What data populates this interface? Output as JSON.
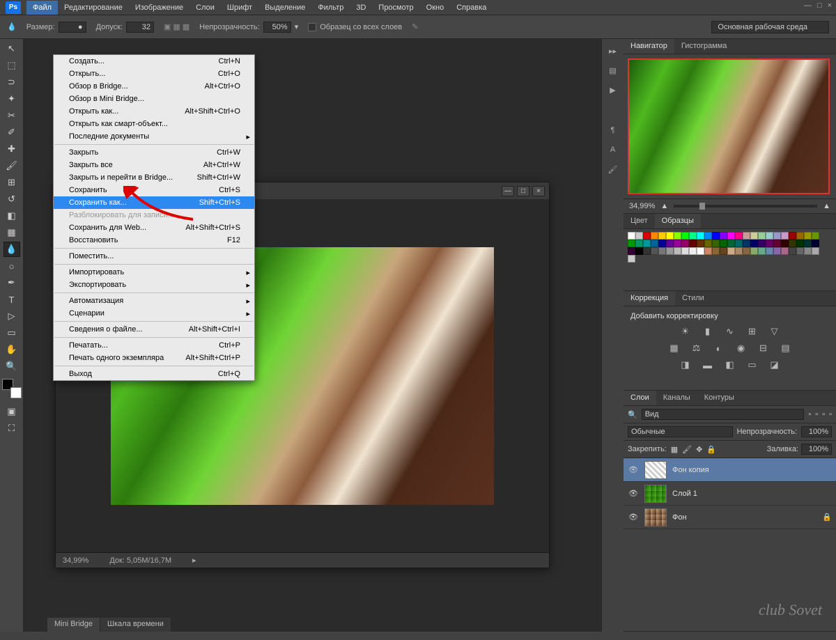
{
  "menubar": [
    "Файл",
    "Редактирование",
    "Изображение",
    "Слои",
    "Шрифт",
    "Выделение",
    "Фильтр",
    "3D",
    "Просмотр",
    "Окно",
    "Справка"
  ],
  "active_menu_index": 0,
  "options": {
    "size_label": "Размер:",
    "tolerance_label": "Допуск:",
    "tolerance_value": "32",
    "opacity_label": "Непрозрачность:",
    "opacity_value": "50%",
    "sample_all_label": "Образец со всех слоев",
    "workspace": "Основная рабочая среда"
  },
  "file_menu": [
    {
      "label": "Создать...",
      "shortcut": "Ctrl+N"
    },
    {
      "label": "Открыть...",
      "shortcut": "Ctrl+O"
    },
    {
      "label": "Обзор в Bridge...",
      "shortcut": "Alt+Ctrl+O"
    },
    {
      "label": "Обзор в Mini Bridge..."
    },
    {
      "label": "Открыть как...",
      "shortcut": "Alt+Shift+Ctrl+O"
    },
    {
      "label": "Открыть как смарт-объект..."
    },
    {
      "label": "Последние документы",
      "submenu": true
    },
    {
      "sep": true
    },
    {
      "label": "Закрыть",
      "shortcut": "Ctrl+W"
    },
    {
      "label": "Закрыть все",
      "shortcut": "Alt+Ctrl+W"
    },
    {
      "label": "Закрыть и перейти в Bridge...",
      "shortcut": "Shift+Ctrl+W"
    },
    {
      "label": "Сохранить",
      "shortcut": "Ctrl+S"
    },
    {
      "label": "Сохранить как...",
      "shortcut": "Shift+Ctrl+S",
      "highlighted": true
    },
    {
      "label": "Разблокировать для записи...",
      "disabled": true
    },
    {
      "label": "Сохранить для Web...",
      "shortcut": "Alt+Shift+Ctrl+S"
    },
    {
      "label": "Восстановить",
      "shortcut": "F12"
    },
    {
      "sep": true
    },
    {
      "label": "Поместить..."
    },
    {
      "sep": true
    },
    {
      "label": "Импортировать",
      "submenu": true
    },
    {
      "label": "Экспортировать",
      "submenu": true
    },
    {
      "sep": true
    },
    {
      "label": "Автоматизация",
      "submenu": true
    },
    {
      "label": "Сценарии",
      "submenu": true
    },
    {
      "sep": true
    },
    {
      "label": "Сведения о файле...",
      "shortcut": "Alt+Shift+Ctrl+I"
    },
    {
      "sep": true
    },
    {
      "label": "Печатать...",
      "shortcut": "Ctrl+P"
    },
    {
      "label": "Печать одного экземпляра",
      "shortcut": "Alt+Shift+Ctrl+P"
    },
    {
      "sep": true
    },
    {
      "label": "Выход",
      "shortcut": "Ctrl+Q"
    }
  ],
  "doc": {
    "zoom": "34,99%",
    "status": "Док: 5,05M/16,7M"
  },
  "navigator": {
    "tab1": "Навигатор",
    "tab2": "Гистограмма",
    "zoom": "34,99%"
  },
  "color_panel": {
    "tab1": "Цвет",
    "tab2": "Образцы"
  },
  "adjustments": {
    "tab1": "Коррекция",
    "tab2": "Стили",
    "title": "Добавить корректировку"
  },
  "layers": {
    "tab1": "Слои",
    "tab2": "Каналы",
    "tab3": "Контуры",
    "kind": "Вид",
    "blend": "Обычные",
    "opacity_label": "Непрозрачность:",
    "opacity": "100%",
    "lock_label": "Закрепить:",
    "fill_label": "Заливка:",
    "fill": "100%",
    "items": [
      {
        "name": "Фон копия"
      },
      {
        "name": "Слой 1"
      },
      {
        "name": "Фон"
      }
    ]
  },
  "bottom_tabs": [
    "Mini Bridge",
    "Шкала времени"
  ],
  "swatch_colors": [
    "#fff",
    "#ccc",
    "#d00",
    "#f80",
    "#fc0",
    "#ff0",
    "#8f0",
    "#0f0",
    "#0f8",
    "#0ff",
    "#08f",
    "#00f",
    "#80f",
    "#f0f",
    "#f08",
    "#c99",
    "#cc9",
    "#9c9",
    "#9cc",
    "#99c",
    "#c9c",
    "#900",
    "#960",
    "#990",
    "#690",
    "#090",
    "#096",
    "#099",
    "#069",
    "#009",
    "#609",
    "#909",
    "#906",
    "#600",
    "#630",
    "#660",
    "#360",
    "#060",
    "#063",
    "#066",
    "#036",
    "#006",
    "#306",
    "#606",
    "#603",
    "#300",
    "#330",
    "#030",
    "#033",
    "#003",
    "#303",
    "#000",
    "#333",
    "#555",
    "#777",
    "#999",
    "#bbb",
    "#ddd",
    "#eee",
    "#fff",
    "#c86",
    "#863",
    "#642",
    "#ca8",
    "#a86",
    "#864",
    "#8a6",
    "#6a8",
    "#68a",
    "#86a",
    "#a68",
    "#444",
    "#666",
    "#888",
    "#aaa",
    "#ccc"
  ],
  "watermark": "club Sovet"
}
